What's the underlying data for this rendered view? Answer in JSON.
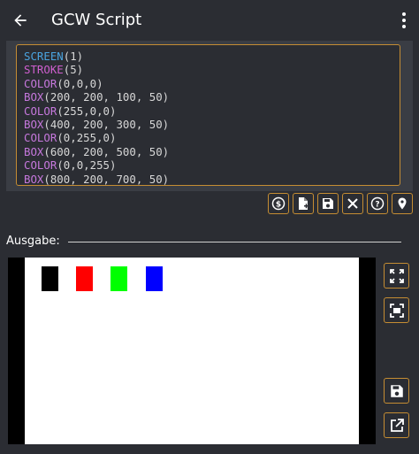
{
  "appbar": {
    "title": "GCW Script"
  },
  "editor": {
    "lines": [
      {
        "fn": "SCREEN",
        "args": "(1)",
        "color": "#4aa3df"
      },
      {
        "fn": "STROKE",
        "args": "(5)",
        "color": "#cf5fcf"
      },
      {
        "fn": "COLOR",
        "args": "(0,0,0)",
        "color": "#c678dd"
      },
      {
        "fn": "BOX",
        "args": "(200, 200, 100, 50)",
        "color": "#c678dd"
      },
      {
        "fn": "COLOR",
        "args": "(255,0,0)",
        "color": "#c678dd"
      },
      {
        "fn": "BOX",
        "args": "(400, 200, 300, 50)",
        "color": "#c678dd"
      },
      {
        "fn": "COLOR",
        "args": "(0,255,0)",
        "color": "#c678dd"
      },
      {
        "fn": "BOX",
        "args": "(600, 200, 500, 50)",
        "color": "#c678dd"
      },
      {
        "fn": "COLOR",
        "args": "(0,0,255)",
        "color": "#c678dd"
      },
      {
        "fn": "BOX",
        "args": "(800, 200, 700, 50)",
        "color": "#c678dd"
      }
    ]
  },
  "toolbar": {
    "buttons": [
      "dollar-circle-icon",
      "new-file-icon",
      "save-icon",
      "close-icon",
      "help-icon",
      "location-pin-icon"
    ]
  },
  "output": {
    "label": "Ausgabe:",
    "boxes": [
      {
        "color": "#000000"
      },
      {
        "color": "#ff0000"
      },
      {
        "color": "#00ff00"
      },
      {
        "color": "#0000ff"
      }
    ]
  },
  "side_buttons": [
    "fullscreen-icon",
    "fit-screen-icon",
    "save-icon",
    "open-external-icon"
  ],
  "colors": {
    "accent": "#c58d33",
    "background": "#2b2d33",
    "editor_panel": "#3a3d44"
  }
}
